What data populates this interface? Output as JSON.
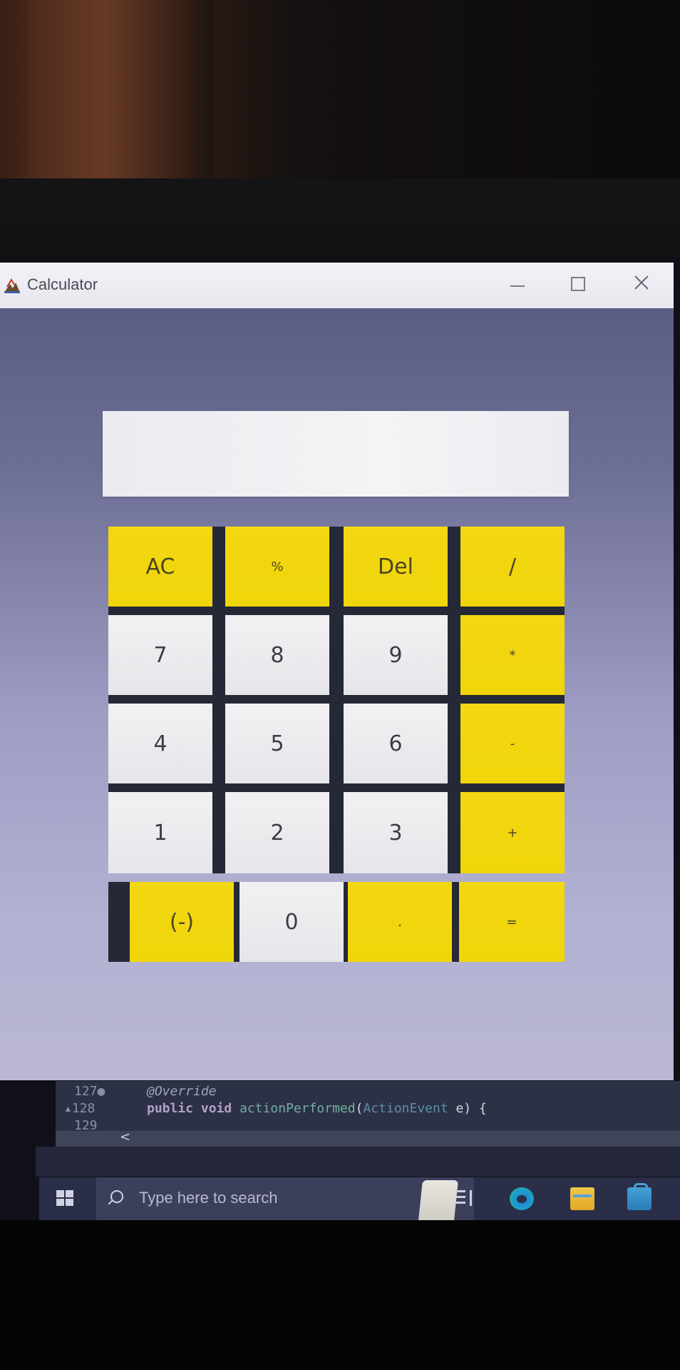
{
  "window": {
    "title": "Calculator",
    "controls": {
      "minimize": "—",
      "maximize": "☐",
      "close": "✕"
    }
  },
  "display": {
    "value": ""
  },
  "keys": [
    {
      "label": "AC",
      "style": "yellow"
    },
    {
      "label": "%",
      "style": "yellow"
    },
    {
      "label": "Del",
      "style": "yellow"
    },
    {
      "label": "/",
      "style": "yellow"
    },
    {
      "label": "7",
      "style": "white"
    },
    {
      "label": "8",
      "style": "white"
    },
    {
      "label": "9",
      "style": "white"
    },
    {
      "label": "*",
      "style": "yellow"
    },
    {
      "label": "4",
      "style": "white"
    },
    {
      "label": "5",
      "style": "white"
    },
    {
      "label": "6",
      "style": "white"
    },
    {
      "label": "-",
      "style": "yellow"
    },
    {
      "label": "1",
      "style": "white"
    },
    {
      "label": "2",
      "style": "white"
    },
    {
      "label": "3",
      "style": "white"
    },
    {
      "label": "+",
      "style": "yellow"
    },
    {
      "label": "(-)",
      "style": "yellow"
    },
    {
      "label": "0",
      "style": "white"
    },
    {
      "label": ".",
      "style": "yellow"
    },
    {
      "label": "=",
      "style": "yellow"
    }
  ],
  "code": {
    "lines": [
      {
        "number": "127",
        "text": "@Override"
      },
      {
        "number": "128",
        "keyword": "public void",
        "method": "actionPerformed",
        "param_type": "ActionEvent",
        "rest": "e) {"
      },
      {
        "number": "129"
      }
    ],
    "scroll_arrow": "<"
  },
  "taskbar": {
    "search_placeholder": "Type here to search",
    "icons": [
      "windows-start-icon",
      "task-view-icon",
      "edge-browser-icon",
      "file-explorer-icon",
      "store-icon"
    ]
  },
  "colors": {
    "key_yellow": "#efd60a",
    "key_white": "#ececef",
    "keypad_gap": "#252836",
    "window_bg": "#9d9cc3"
  }
}
